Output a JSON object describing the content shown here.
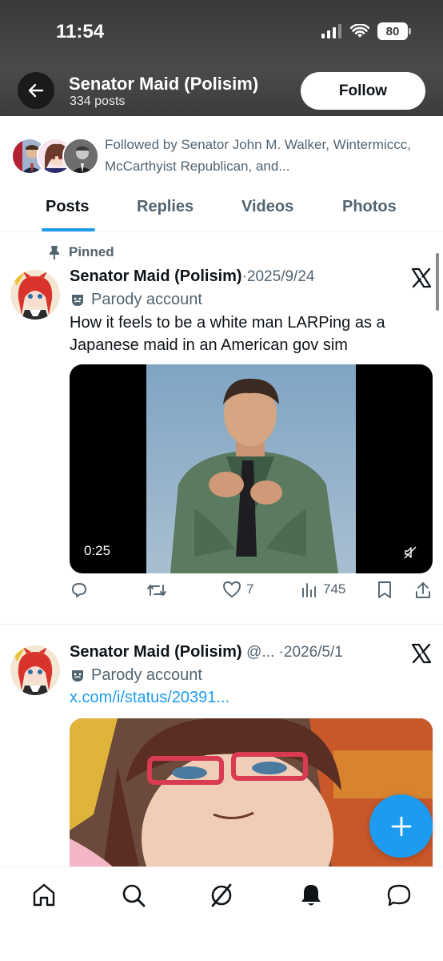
{
  "status_bar": {
    "time": "11:54",
    "battery": "80"
  },
  "header": {
    "name": "Senator Maid (Polisim)",
    "post_count": "334 posts",
    "follow_label": "Follow"
  },
  "followed_by": {
    "text": "Followed by Senator John M. Walker, Wintermiccc, McCarthyist Republican, and..."
  },
  "tabs": [
    {
      "label": "Posts",
      "active": true
    },
    {
      "label": "Replies",
      "active": false
    },
    {
      "label": "Videos",
      "active": false
    },
    {
      "label": "Photos",
      "active": false
    }
  ],
  "posts": [
    {
      "pinned_label": "Pinned",
      "author": "Senator Maid (Polisim)",
      "meta": "·2025/9/24",
      "parody_label": "Parody account",
      "text": "How it feels to be a white man LARPing as a Japanese maid in an American gov sim",
      "video_time": "0:25",
      "likes": "7",
      "views": "745"
    },
    {
      "author": "Senator Maid (Polisim)",
      "meta": "@... ·2026/5/1",
      "parody_label": "Parody account",
      "link": "x.com/i/status/20391..."
    }
  ],
  "colors": {
    "accent": "#1d9bf0",
    "text": "#0f1419",
    "muted": "#536471",
    "header_bg": "#444444"
  },
  "icons": {
    "back": "arrow-left-icon",
    "pin": "pin-icon",
    "x_logo": "x-logo-icon",
    "parody": "theater-mask-icon",
    "reply": "reply-icon",
    "repost": "repost-icon",
    "like": "heart-icon",
    "views": "views-icon",
    "bookmark": "bookmark-icon",
    "share": "share-icon",
    "compose": "plus-icon",
    "nav": [
      "home-icon",
      "search-icon",
      "grok-icon",
      "notifications-icon",
      "messages-icon"
    ]
  }
}
